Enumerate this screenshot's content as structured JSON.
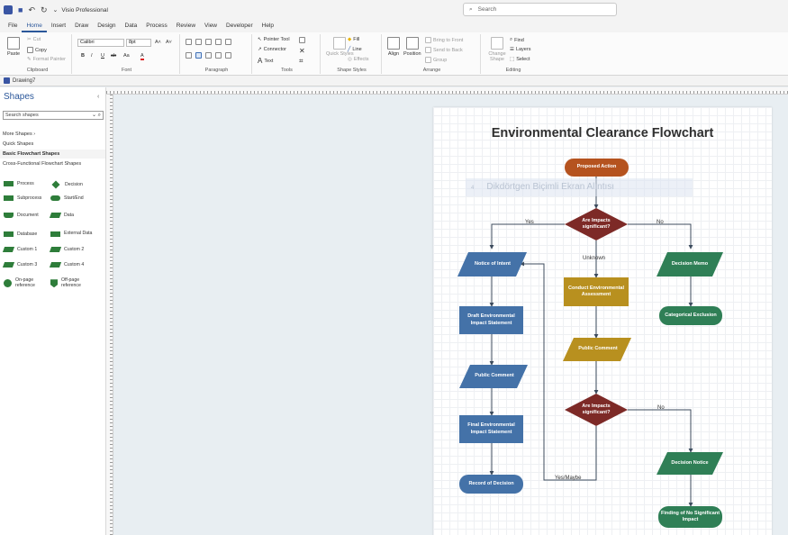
{
  "titlebar": {
    "app_title": "Visio Professional",
    "search_placeholder": "Search"
  },
  "menu": {
    "tabs": [
      "File",
      "Home",
      "Insert",
      "Draw",
      "Design",
      "Data",
      "Process",
      "Review",
      "View",
      "Developer",
      "Help"
    ],
    "active": "Home"
  },
  "ribbon": {
    "clipboard": {
      "label": "Clipboard",
      "paste": "Paste",
      "cut": "Cut",
      "copy": "Copy",
      "format_painter": "Format Painter"
    },
    "font": {
      "label": "Font",
      "family": "Calibri",
      "size": "8pt",
      "grow": "A˄",
      "shrink": "A˅",
      "bold": "B",
      "italic": "I",
      "underline": "U",
      "strike": "ab",
      "case": "Aa",
      "color": "A"
    },
    "paragraph": {
      "label": "Paragraph"
    },
    "tools": {
      "label": "Tools",
      "pointer": "Pointer Tool",
      "connector": "Connector",
      "text": "Text"
    },
    "shape_styles": {
      "label": "Shape Styles",
      "quick_styles": "Quick Styles",
      "fill": "Fill",
      "line": "Line",
      "effects": "Effects"
    },
    "arrange": {
      "label": "Arrange",
      "align": "Align",
      "position": "Position",
      "bring_front": "Bring to Front",
      "send_back": "Send to Back",
      "group": "Group"
    },
    "editing": {
      "label": "Editing",
      "change_shape": "Change Shape",
      "find": "Find",
      "layers": "Layers",
      "select": "Select"
    }
  },
  "document": {
    "name": "Drawing7"
  },
  "shapes_pane": {
    "title": "Shapes",
    "search_placeholder": "Search shapes",
    "more_shapes": "More Shapes",
    "quick_shapes": "Quick Shapes",
    "basic_flowchart": "Basic Flowchart Shapes",
    "cross_functional": "Cross-Functional Flowchart Shapes",
    "items": [
      {
        "label": "Process",
        "col": 0
      },
      {
        "label": "Decision",
        "col": 1
      },
      {
        "label": "Subprocess",
        "col": 0
      },
      {
        "label": "Start/End",
        "col": 1
      },
      {
        "label": "Document",
        "col": 0
      },
      {
        "label": "Data",
        "col": 1
      },
      {
        "label": "Database",
        "col": 0
      },
      {
        "label": "External Data",
        "col": 1
      },
      {
        "label": "Custom 1",
        "col": 0
      },
      {
        "label": "Custom 2",
        "col": 1
      },
      {
        "label": "Custom 3",
        "col": 0
      },
      {
        "label": "Custom 4",
        "col": 1
      },
      {
        "label": "On-page reference",
        "col": 0
      },
      {
        "label": "Off-page reference",
        "col": 1
      }
    ]
  },
  "flowchart": {
    "title": "Environmental Clearance Flowchart",
    "ghost_text": "Dikdörtgen Biçimli Ekran Alıntısı",
    "ghost_num": "4",
    "colors": {
      "terminator": "#b5531f",
      "decision": "#7d2a27",
      "process_blue": "#4472a8",
      "process_gold": "#b8901f",
      "green": "#2f7f56",
      "edge": "#3c4b5d"
    },
    "nodes": {
      "proposed_action": "Proposed Action",
      "decision1": "Are Impacts significant?",
      "notice_intent": "Notice of Intent",
      "decision_memo": "Decision Memo",
      "conduct_ea": "Conduct Environmental Assessment",
      "categorical_exclusion": "Categorical Exclusion",
      "draft_eis": "Draft Environmental Impact Statement",
      "public_comment_left": "Public Comment",
      "public_comment_mid": "Public Comment",
      "decision2": "Are Impacts significant?",
      "final_eis": "Final Environmental Impact Statement",
      "decision_notice": "Decision Notice",
      "record_decision": "Record of Decision",
      "fonsi": "Finding of No Significant Impact"
    },
    "edges": {
      "yes": "Yes",
      "no": "No",
      "unknown": "Unknown",
      "no2": "No",
      "yes_maybe": "Yes/Maybe"
    }
  }
}
